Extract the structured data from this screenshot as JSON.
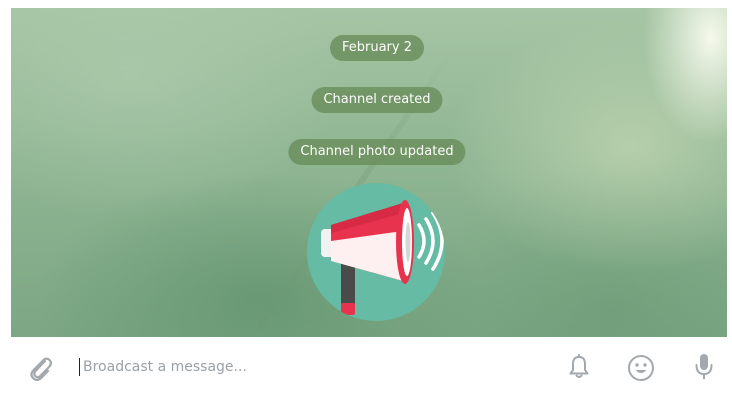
{
  "chat": {
    "service_messages": [
      "February 2",
      "Channel created",
      "Channel photo updated"
    ],
    "channel_photo": {
      "icon": "megaphone-icon",
      "background_color": "#65bba4"
    }
  },
  "composer": {
    "placeholder": "Broadcast a message...",
    "value": "",
    "attach_icon": "paperclip-icon",
    "notify_icon": "bell-icon",
    "emoji_icon": "smiley-icon",
    "voice_icon": "microphone-icon",
    "icon_color": "#a3a9ae"
  }
}
